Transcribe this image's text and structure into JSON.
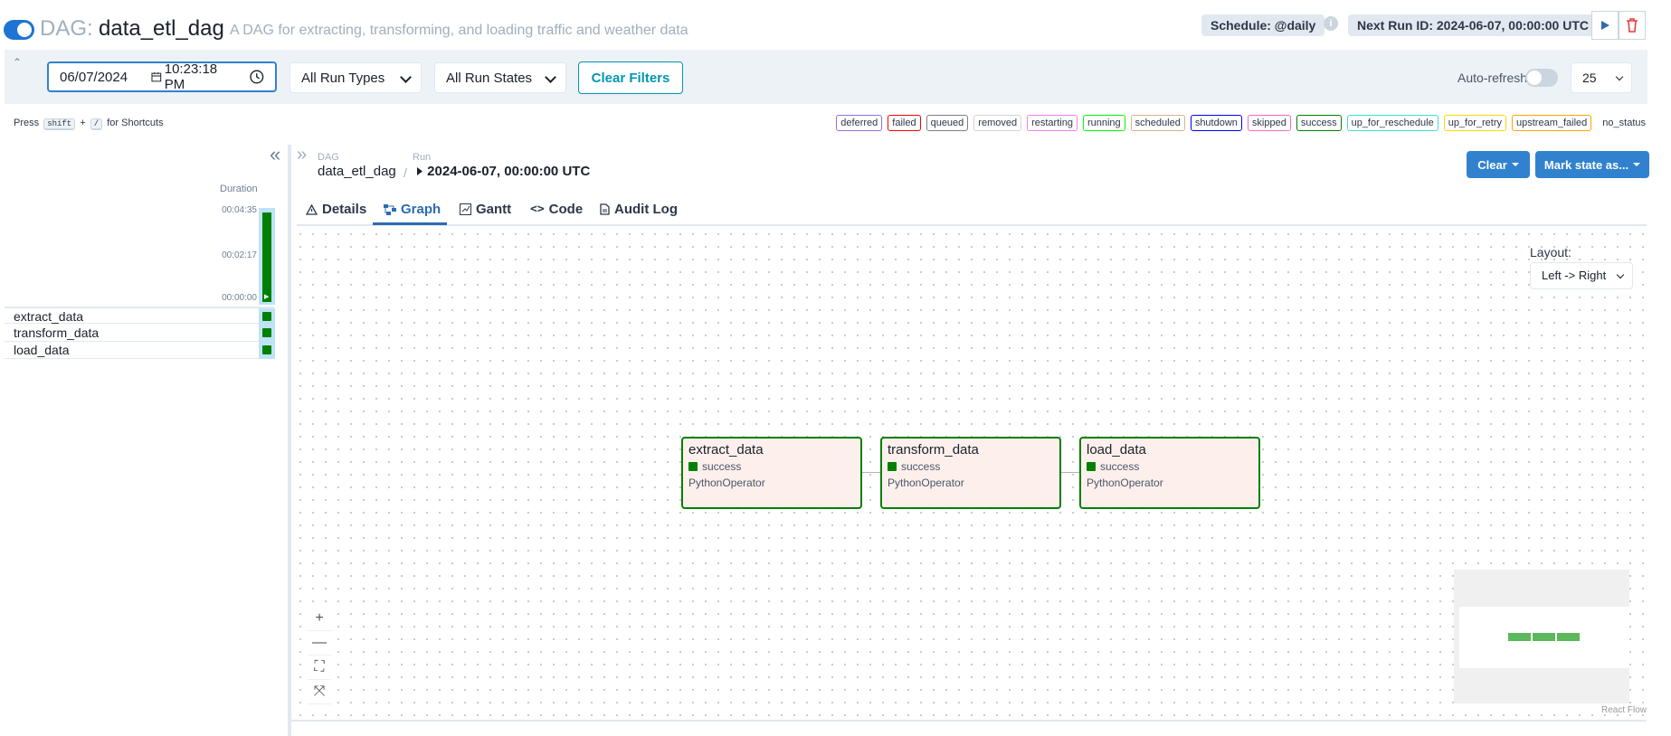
{
  "header": {
    "dag_prefix": "DAG:",
    "dag_id": "data_etl_dag",
    "description": "A DAG for extracting, transforming, and loading traffic and weather data",
    "schedule": "Schedule: @daily",
    "next_run": "Next Run ID: 2024-06-07, 00:00:00 UTC",
    "info_icon": "i"
  },
  "filters": {
    "date": "06/07/2024",
    "time": "10:23:18 PM",
    "run_types": "All Run Types",
    "run_states": "All Run States",
    "clear_filters": "Clear Filters",
    "auto_refresh": "Auto-refresh",
    "page_size": "25"
  },
  "shortcuts": {
    "press": "Press",
    "key1": "shift",
    "plus": "+",
    "key2": "/",
    "suffix": "for Shortcuts"
  },
  "legend": [
    {
      "label": "deferred",
      "color": "#9370db"
    },
    {
      "label": "failed",
      "color": "#ff0000"
    },
    {
      "label": "queued",
      "color": "#808080"
    },
    {
      "label": "removed",
      "color": "#d3d3d3"
    },
    {
      "label": "restarting",
      "color": "#ee82ee"
    },
    {
      "label": "running",
      "color": "#00ff00"
    },
    {
      "label": "scheduled",
      "color": "#d2b48c"
    },
    {
      "label": "shutdown",
      "color": "#0000ff"
    },
    {
      "label": "skipped",
      "color": "#ff69b4"
    },
    {
      "label": "success",
      "color": "#008000"
    },
    {
      "label": "up_for_reschedule",
      "color": "#40e0d0"
    },
    {
      "label": "up_for_retry",
      "color": "#ffd700"
    },
    {
      "label": "upstream_failed",
      "color": "#ffa500"
    },
    {
      "label": "no_status",
      "color": "#ffffff"
    }
  ],
  "grid": {
    "duration_label": "Duration",
    "ticks": [
      "00:04:35",
      "00:02:17",
      "00:00:00"
    ],
    "tasks": [
      "extract_data",
      "transform_data",
      "load_data"
    ]
  },
  "breadcrumb": {
    "dag_label": "DAG",
    "dag_value": "data_etl_dag",
    "separator": "/",
    "run_label": "Run",
    "run_value": "2024-06-07, 00:00:00 UTC"
  },
  "actions": {
    "clear": "Clear",
    "mark_state": "Mark state as..."
  },
  "tabs": [
    "Details",
    "Graph",
    "Gantt",
    "Code",
    "Audit Log"
  ],
  "graph": {
    "layout_label": "Layout:",
    "layout_value": "Left -> Right",
    "nodes": [
      {
        "name": "extract_data",
        "state": "success",
        "operator": "PythonOperator"
      },
      {
        "name": "transform_data",
        "state": "success",
        "operator": "PythonOperator"
      },
      {
        "name": "load_data",
        "state": "success",
        "operator": "PythonOperator"
      }
    ],
    "zoom_controls": [
      "+",
      "—",
      "⛶",
      "⤧"
    ],
    "attribution": "React Flow"
  }
}
